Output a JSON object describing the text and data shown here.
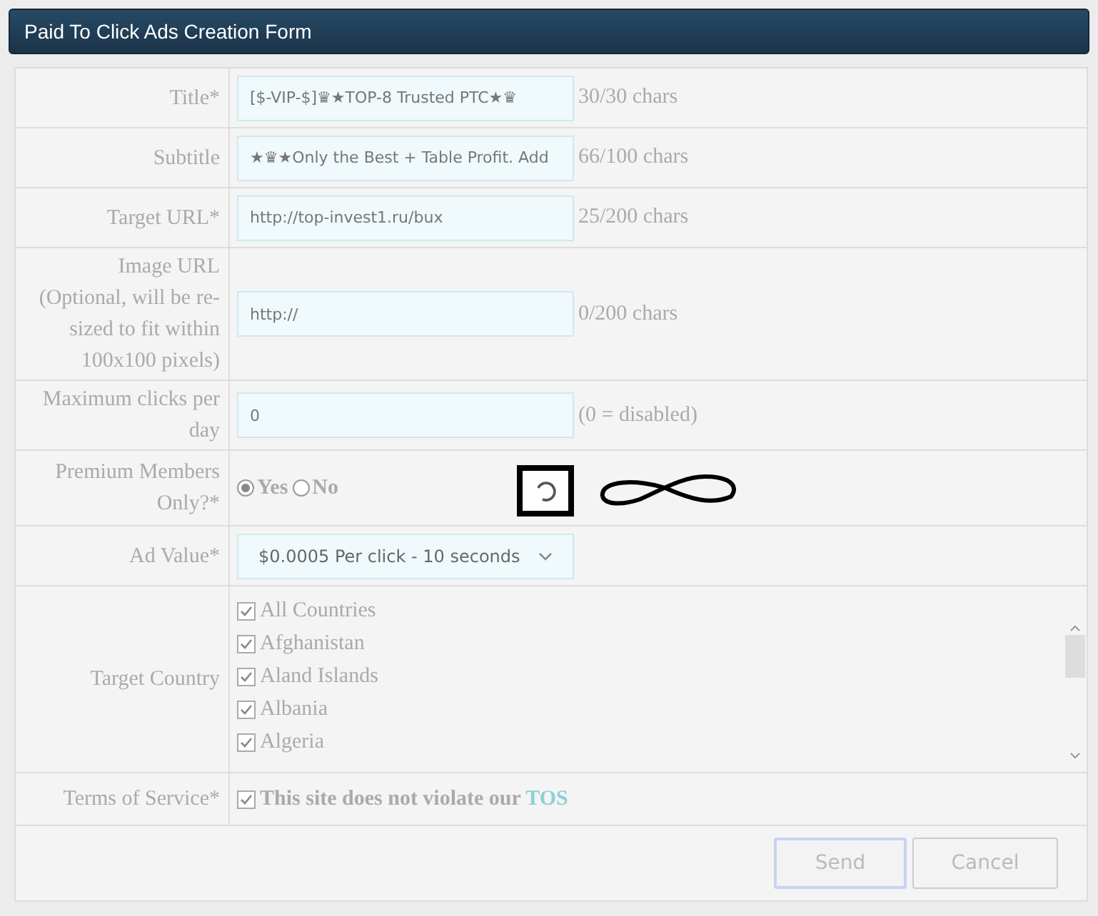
{
  "header": {
    "title": "Paid To Click Ads Creation Form"
  },
  "rows": [
    {
      "kind": "input",
      "label": "Title*",
      "value": "[$-VIP-$]♛★TOP-8 Trusted PTC★♛",
      "note": "30/30 chars"
    },
    {
      "kind": "input",
      "label": "Subtitle",
      "value": "★♛★Only the Best + Table Profit. Add",
      "note": "66/100 chars"
    },
    {
      "kind": "input",
      "label": "Target URL*",
      "value": "http://top-invest1.ru/bux",
      "note": "25/200 chars"
    },
    {
      "kind": "input",
      "label": "Image URL (Optional, will be re-sized to fit within 100x100 pixels)",
      "value": "http://",
      "note": "0/200 chars"
    },
    {
      "kind": "input",
      "label": "Maximum clicks per day",
      "value": "0",
      "note": "(0 = disabled)"
    },
    {
      "kind": "radio",
      "label": "Premium Members Only?*",
      "options": [
        {
          "label": "Yes",
          "selected": true
        },
        {
          "label": "No",
          "selected": false
        }
      ]
    },
    {
      "kind": "select",
      "label": "Ad Value*",
      "value": "$0.0005 Per click - 10 seconds"
    },
    {
      "kind": "checklist",
      "label": "Target Country",
      "items": [
        {
          "label": "All Countries",
          "checked": true
        },
        {
          "label": "Afghanistan",
          "checked": true
        },
        {
          "label": "Aland Islands",
          "checked": true
        },
        {
          "label": "Albania",
          "checked": true
        },
        {
          "label": "Algeria",
          "checked": true
        }
      ]
    },
    {
      "kind": "checkbox",
      "label": "Terms of Service*",
      "text": "This site does not violate our ",
      "link": "TOS",
      "checked": true
    }
  ],
  "buttons": [
    {
      "label": "Send",
      "focused": true
    },
    {
      "label": "Cancel",
      "focused": false
    }
  ]
}
